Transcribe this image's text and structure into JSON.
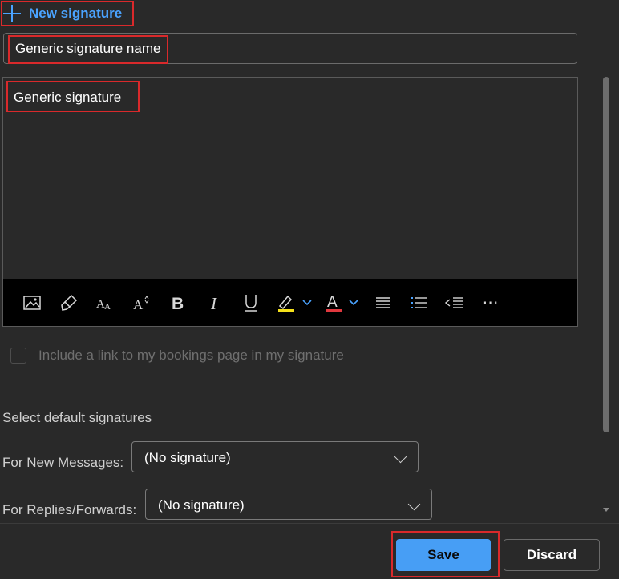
{
  "new_signature": {
    "label": "New signature",
    "icon": "plus-icon"
  },
  "signature_name": {
    "value": "Generic signature name"
  },
  "editor": {
    "content": "Generic signature"
  },
  "toolbar": {
    "items": [
      "image-icon",
      "format-painter-icon",
      "font-icon",
      "font-size-icon",
      "bold-icon",
      "italic-icon",
      "underline-icon",
      "highlight-icon",
      "font-color-icon",
      "bullets-icon",
      "numbering-icon",
      "decrease-indent-icon",
      "more-options-icon"
    ],
    "highlight_color": "#f5e11a",
    "font_color": "#e0383e",
    "more_label": "⋯"
  },
  "bookings": {
    "label": "Include a link to my bookings page in my signature",
    "checked": false
  },
  "defaults": {
    "heading": "Select default signatures",
    "new_messages_label": "For New Messages:",
    "new_messages_value": "(No signature)",
    "replies_label": "For Replies/Forwards:",
    "replies_value": "(No signature)"
  },
  "buttons": {
    "save": "Save",
    "discard": "Discard"
  },
  "colors": {
    "accent": "#479ef5",
    "highlight_box": "#d9292b",
    "background": "#292929"
  }
}
